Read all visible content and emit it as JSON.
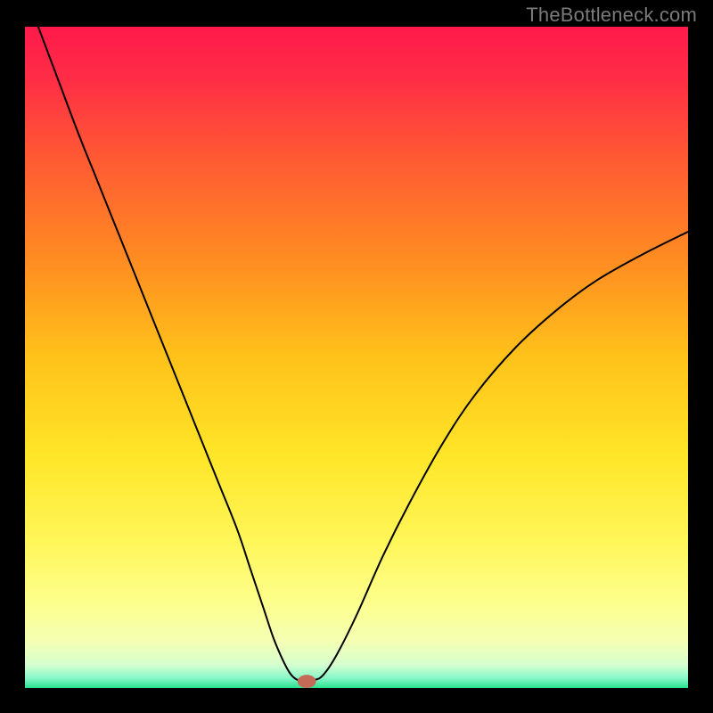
{
  "watermark": "TheBottleneck.com",
  "chart_data": {
    "type": "line",
    "title": "",
    "xlabel": "",
    "ylabel": "",
    "xlim": [
      0,
      100
    ],
    "ylim": [
      0,
      100
    ],
    "grid": false,
    "legend": false,
    "background_gradient": {
      "stops": [
        {
          "offset": 0.0,
          "color": "#ff1a4b"
        },
        {
          "offset": 0.08,
          "color": "#ff2e46"
        },
        {
          "offset": 0.2,
          "color": "#ff5a33"
        },
        {
          "offset": 0.35,
          "color": "#ff8b22"
        },
        {
          "offset": 0.5,
          "color": "#ffc21a"
        },
        {
          "offset": 0.65,
          "color": "#ffe628"
        },
        {
          "offset": 0.78,
          "color": "#fff65a"
        },
        {
          "offset": 0.87,
          "color": "#fdff8c"
        },
        {
          "offset": 0.93,
          "color": "#f4ffb4"
        },
        {
          "offset": 0.965,
          "color": "#d6ffcf"
        },
        {
          "offset": 0.985,
          "color": "#88f7c9"
        },
        {
          "offset": 1.0,
          "color": "#27e18e"
        }
      ]
    },
    "curve": {
      "description": "V-shaped bottleneck curve with rounded minimum",
      "x": [
        2,
        5,
        8,
        11,
        14,
        17,
        20,
        23,
        26,
        29,
        32,
        34,
        36,
        37.5,
        39,
        40,
        40.8,
        41.5,
        43.5,
        45,
        47,
        50,
        54,
        58,
        63,
        68,
        74,
        80,
        86,
        93,
        100
      ],
      "y": [
        100,
        92,
        84,
        76.5,
        69,
        61.5,
        54,
        46.5,
        39,
        31.5,
        24,
        18,
        12,
        7.5,
        4,
        2.2,
        1.4,
        1.2,
        1.2,
        2,
        5,
        11,
        20,
        28,
        37,
        44.5,
        51.5,
        57,
        61.5,
        65.5,
        69
      ]
    },
    "marker": {
      "x": 42.5,
      "y": 1.0,
      "color": "#c46a57",
      "rx": 1.4,
      "ry": 1.0
    }
  }
}
